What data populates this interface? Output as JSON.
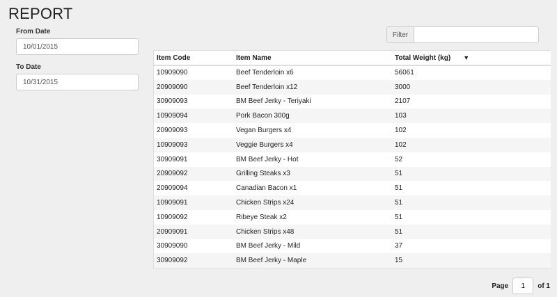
{
  "title": "REPORT",
  "from_date": {
    "label": "From Date",
    "value": "10/01/2015"
  },
  "to_date": {
    "label": "To Date",
    "value": "10/31/2015"
  },
  "filter": {
    "label": "Filter",
    "value": ""
  },
  "table": {
    "columns": [
      "Item Code",
      "Item Name",
      "Total Weight (kg)"
    ],
    "sort_indicator": "▼",
    "rows": [
      [
        "10909090",
        "Beef Tenderloin x6",
        "56061"
      ],
      [
        "20909090",
        "Beef Tenderloin x12",
        "3000"
      ],
      [
        "30909093",
        "BM Beef Jerky - Teriyaki",
        "2107"
      ],
      [
        "10909094",
        "Pork Bacon 300g",
        "103"
      ],
      [
        "20909093",
        "Vegan Burgers x4",
        "102"
      ],
      [
        "10909093",
        "Veggie Burgers x4",
        "102"
      ],
      [
        "30909091",
        "BM Beef Jerky - Hot",
        "52"
      ],
      [
        "20909092",
        "Grilling Steaks x3",
        "51"
      ],
      [
        "20909094",
        "Canadian Bacon x1",
        "51"
      ],
      [
        "10909091",
        "Chicken Strips x24",
        "51"
      ],
      [
        "10909092",
        "Ribeye Steak x2",
        "51"
      ],
      [
        "20909091",
        "Chicken Strips x48",
        "51"
      ],
      [
        "30909090",
        "BM Beef Jerky - Mild",
        "37"
      ],
      [
        "30909092",
        "BM Beef Jerky - Maple",
        "15"
      ]
    ]
  },
  "pager": {
    "page_label": "Page",
    "current": "1",
    "of_label": "of 1"
  }
}
